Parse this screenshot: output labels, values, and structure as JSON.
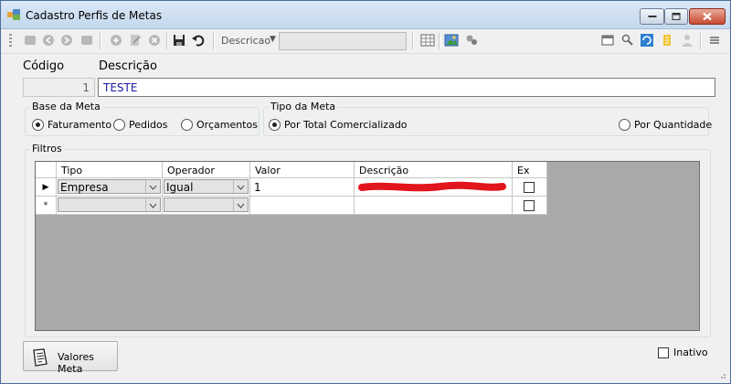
{
  "window": {
    "title": "Cadastro Perfis de Metas"
  },
  "toolbar": {
    "descricao_label": "Descricao",
    "descricao_value": "",
    "left_icons": [
      "first-record-icon",
      "prev-record-icon",
      "next-record-icon",
      "last-record-icon",
      "add-icon",
      "edit-icon",
      "delete-icon",
      "save-icon",
      "undo-icon"
    ],
    "right_icons": [
      "grid-view-icon",
      "image-icon",
      "tools-icon",
      "window-icon",
      "find-icon",
      "refresh-icon",
      "file-icon",
      "user-icon",
      "menu-icon"
    ]
  },
  "form": {
    "codigo_label": "Código",
    "codigo_value": "1",
    "descricao_label": "Descrição",
    "descricao_value": "TESTE"
  },
  "base_meta": {
    "title": "Base da Meta",
    "options": [
      {
        "label": "Faturamento",
        "selected": true
      },
      {
        "label": "Pedidos",
        "selected": false
      },
      {
        "label": "Orçamentos",
        "selected": false
      }
    ]
  },
  "tipo_meta": {
    "title": "Tipo da Meta",
    "options": [
      {
        "label": "Por Total Comercializado",
        "selected": true
      },
      {
        "label": "Por Quantidade",
        "selected": false
      }
    ]
  },
  "filtros": {
    "title": "Filtros",
    "columns": [
      "Tipo",
      "Operador",
      "Valor",
      "Descrição",
      "Ex"
    ],
    "rows": [
      {
        "marker": "▶",
        "tipo": "Empresa",
        "operador": "Igual",
        "valor": "1",
        "descricao": "",
        "ex": false
      },
      {
        "marker": "*",
        "tipo": "",
        "operador": "",
        "valor": "",
        "descricao": "",
        "ex": false
      }
    ]
  },
  "footer": {
    "valores_label": "Valores Meta",
    "inativo_label": "Inativo",
    "inativo_checked": false
  },
  "colors": {
    "title_bar": "#dbe8f6",
    "grid_background": "#a9a9a9",
    "descricao_text": "#1a1aa6",
    "redaction": "#e2141c"
  }
}
